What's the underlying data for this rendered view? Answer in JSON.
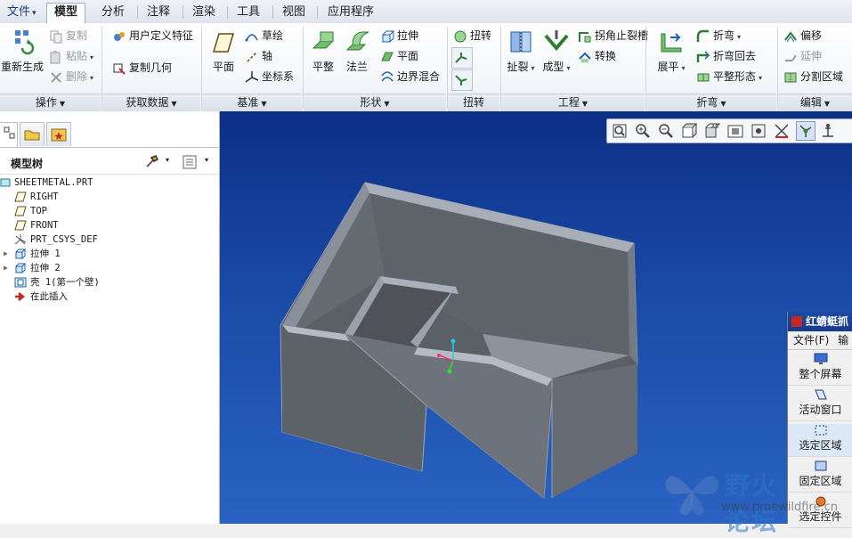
{
  "menu": {
    "file": "文件",
    "tabs": [
      "模型",
      "分析",
      "注释",
      "渲染",
      "工具",
      "视图",
      "应用程序"
    ],
    "active": "模型"
  },
  "ribbon": {
    "operations": {
      "label": "操作",
      "regen": "重新生成",
      "copy": "复制",
      "paste": "粘贴",
      "delete": "删除"
    },
    "get_data": {
      "label": "获取数据",
      "user_feature": "用户定义特征",
      "copy_geometry": "复制几何"
    },
    "datum": {
      "label": "基准",
      "plane": "平面",
      "sketch": "草绘",
      "axis": "轴",
      "csys": "坐标系"
    },
    "shapes": {
      "label": "形状",
      "flat": "平整",
      "flange": "法兰",
      "extrude": "拉伸",
      "plane": "平面",
      "boundary_blend": "边界混合"
    },
    "twist": {
      "label": "扭转",
      "twist": "扭转"
    },
    "engineering": {
      "label": "工程",
      "rip": "扯裂",
      "form": "成型",
      "corner_relief": "拐角止裂槽",
      "convert": "转换"
    },
    "bend": {
      "label": "折弯",
      "unbend": "展平",
      "bend": "折弯",
      "bend_back": "折弯回去",
      "flat_pattern": "平整形态"
    },
    "edit": {
      "label": "编辑",
      "offset": "偏移",
      "extend": "延伸",
      "split_area": "分割区域"
    }
  },
  "model_tree": {
    "title": "模型树",
    "items": [
      {
        "label": "SHEETMETAL.PRT",
        "icon": "part-icon",
        "level": 0
      },
      {
        "label": "RIGHT",
        "icon": "datum-plane-icon",
        "level": 1
      },
      {
        "label": "TOP",
        "icon": "datum-plane-icon",
        "level": 1
      },
      {
        "label": "FRONT",
        "icon": "datum-plane-icon",
        "level": 1
      },
      {
        "label": "PRT_CSYS_DEF",
        "icon": "csys-icon",
        "level": 1
      },
      {
        "label": "拉伸 1",
        "icon": "extrude-icon",
        "level": 1,
        "expandable": true
      },
      {
        "label": "拉伸 2",
        "icon": "extrude-icon",
        "level": 1,
        "expandable": true
      },
      {
        "label": "壳 1(第一个壁)",
        "icon": "shell-icon",
        "level": 1
      },
      {
        "label": "在此插入",
        "icon": "insert-arrow-icon",
        "level": 1
      }
    ]
  },
  "float_window": {
    "title": "红蜻蜓抓图",
    "menu_file": "文件(F)",
    "menu_next": "输",
    "items": [
      "整个屏幕",
      "活动窗口",
      "选定区域",
      "固定区域",
      "选定控件"
    ],
    "selected": "选定区域"
  },
  "watermark": {
    "title": "野火论坛",
    "url": "www.proewildfire.cn"
  },
  "colors": {
    "viewport_top": "#0c2f86",
    "viewport_bottom": "#2a63c2",
    "model_face": "#7c8088",
    "model_edge": "#b8bfcb"
  }
}
